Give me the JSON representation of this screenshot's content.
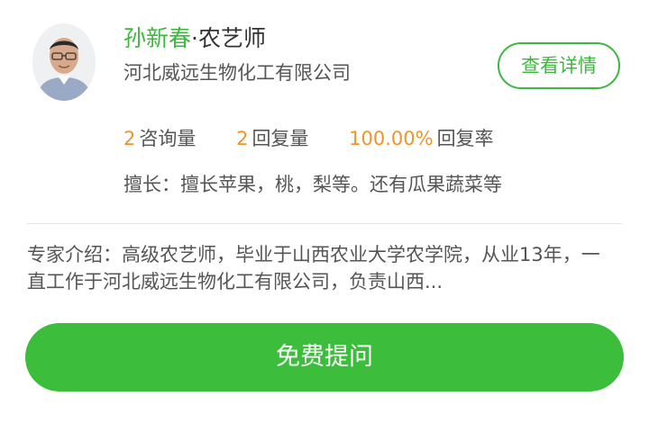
{
  "expert": {
    "name": "孙新春",
    "title": "·农艺师",
    "company": "河北威远生物化工有限公司",
    "detail_button": "查看详情",
    "avatar_icon": "person-avatar-icon"
  },
  "stats": [
    {
      "value": "2",
      "label": "咨询量"
    },
    {
      "value": "2",
      "label": "回复量"
    },
    {
      "value": "100.00%",
      "label": "回复率"
    }
  ],
  "specialty": "擅长：擅长苹果，桃，梨等。还有瓜果蔬菜等",
  "intro": "专家介绍：高级农艺师，毕业于山西农业大学农学院，从业13年，一直工作于河北威远生物化工有限公司，负责山西...",
  "ask_button": "免费提问",
  "colors": {
    "accent": "#3cb83c",
    "stat_number": "#f0932b",
    "button_bg": "#3cbe3c"
  }
}
